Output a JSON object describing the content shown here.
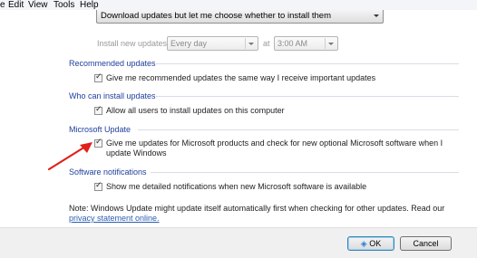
{
  "menu": {
    "edit": "Edit",
    "view": "View",
    "tools": "Tools",
    "help": "Help"
  },
  "important_updates": {
    "selected": "Download updates but let me choose whether to install them"
  },
  "install_schedule": {
    "label": "Install new updates:",
    "day_value": "Every day",
    "at_label": "at",
    "time_value": "3:00 AM"
  },
  "recommended": {
    "title": "Recommended updates",
    "checkbox_label": "Give me recommended updates the same way I receive important updates",
    "checked": true
  },
  "who_can_install": {
    "title": "Who can install updates",
    "checkbox_label": "Allow all users to install updates on this computer",
    "checked": true
  },
  "microsoft_update": {
    "title": "Microsoft Update",
    "checkbox_label_line1": "Give me updates for Microsoft products and check for new optional Microsoft software when I",
    "checkbox_label_line2": "update Windows",
    "checked": true
  },
  "software_notifications": {
    "title": "Software notifications",
    "checkbox_label": "Show me detailed notifications when new Microsoft software is available",
    "checked": true
  },
  "note": {
    "text": "Note: Windows Update might update itself automatically first when checking for other updates.  Read our",
    "link": "privacy statement online."
  },
  "buttons": {
    "ok": "OK",
    "cancel": "Cancel"
  },
  "colors": {
    "section_title": "#1f3f9c",
    "link": "#2a5db0",
    "annotation_arrow": "#e0201b"
  }
}
